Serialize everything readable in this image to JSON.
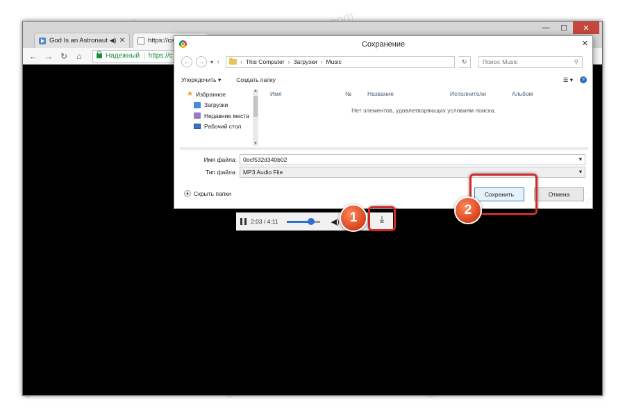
{
  "browser": {
    "tabs": [
      {
        "label": "God Is an Astronaut",
        "icon": "youtube-icon"
      },
      {
        "label": "https://cs",
        "icon": "document-icon"
      }
    ],
    "window_controls": {
      "minimize": "—",
      "maximize": "☐",
      "close": "✕"
    },
    "address": {
      "secure_label": "Надежный",
      "url": "https://c"
    }
  },
  "dialog": {
    "title": "Сохранение",
    "path": {
      "root": "This Computer",
      "folder1": "Загрузки",
      "folder2": "Music"
    },
    "search_placeholder": "Поиск: Music",
    "toolbar": {
      "organize": "Упорядочить ▾",
      "new_folder": "Создать папку"
    },
    "tree": {
      "favorites": "Избранное",
      "items": [
        "Загрузки",
        "Недавние места",
        "Рабочий стол"
      ]
    },
    "columns": {
      "name": "Имя",
      "number": "№",
      "title": "Название",
      "artists": "Исполнители",
      "album": "Альбом"
    },
    "empty_message": "Нет элементов, удовлетворяющих условиям поиска.",
    "filename_label": "Имя файла:",
    "filename_value": "0ecf532d340b02",
    "filetype_label": "Тип файла:",
    "filetype_value": "MP3 Audio File",
    "hide_folders": "Скрыть папки",
    "save_button": "Сохранить",
    "cancel_button": "Отмена"
  },
  "player": {
    "time": "2:03 / 4:11",
    "volume_fraction": 0.7
  },
  "badges": {
    "one": "1",
    "two": "2"
  },
  "watermark": "Soringpcrepair.com",
  "colors": {
    "accent_red": "#d22a2a",
    "badge": "#d8421c",
    "secure_green": "#1e8e3e"
  }
}
